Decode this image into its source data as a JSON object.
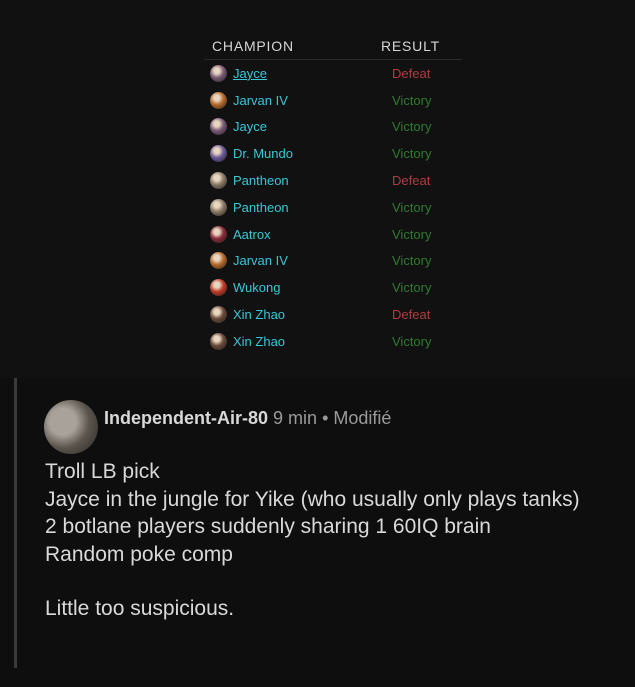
{
  "table": {
    "header_champion": "CHAMPION",
    "header_result": "RESULT",
    "rows": [
      {
        "champion": "Jayce",
        "result": "Defeat",
        "avatar_color": "#7a5a78"
      },
      {
        "champion": "Jarvan IV",
        "result": "Victory",
        "avatar_color": "#b66a2a"
      },
      {
        "champion": "Jayce",
        "result": "Victory",
        "avatar_color": "#7a5a78"
      },
      {
        "champion": "Dr. Mundo",
        "result": "Victory",
        "avatar_color": "#6c5a9a"
      },
      {
        "champion": "Pantheon",
        "result": "Defeat",
        "avatar_color": "#8a7a66"
      },
      {
        "champion": "Pantheon",
        "result": "Victory",
        "avatar_color": "#8a7a66"
      },
      {
        "champion": "Aatrox",
        "result": "Victory",
        "avatar_color": "#8a2a3a"
      },
      {
        "champion": "Jarvan IV",
        "result": "Victory",
        "avatar_color": "#b66a2a"
      },
      {
        "champion": "Wukong",
        "result": "Victory",
        "avatar_color": "#c23a2a"
      },
      {
        "champion": "Xin Zhao",
        "result": "Defeat",
        "avatar_color": "#6a4a3a"
      },
      {
        "champion": "Xin Zhao",
        "result": "Victory",
        "avatar_color": "#6a4a3a"
      }
    ]
  },
  "comment": {
    "author": "Independent-Air-80",
    "time": "9 min",
    "separator": "•",
    "edited": "Modifié",
    "lines": [
      "Troll LB pick",
      "Jayce in the jungle for Yike (who usually only plays tanks)",
      "2 botlane players suddenly sharing 1 60IQ brain",
      "Random poke comp"
    ],
    "closing": "Little too suspicious."
  }
}
